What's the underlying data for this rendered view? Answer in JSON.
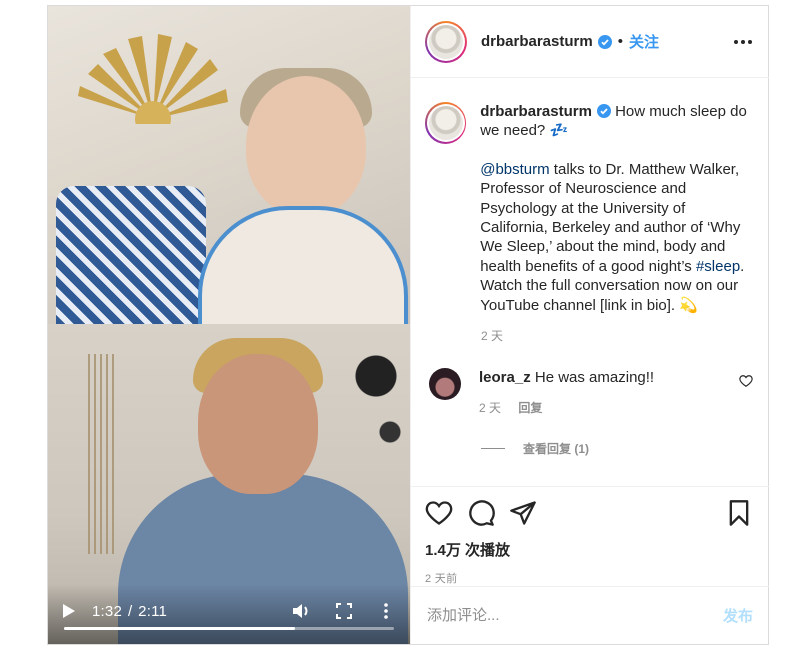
{
  "video": {
    "current_time": "1:32",
    "separator": "/",
    "duration": "2:11",
    "progress_fraction": 0.7
  },
  "header": {
    "username": "drbarbarasturm",
    "dot": "•",
    "follow_label": "关注"
  },
  "caption": {
    "username": "drbarbarasturm",
    "line1": "How much sleep do we need? 💤",
    "mention": "@bbsturm",
    "body_part1": " talks to Dr. Matthew Walker, Professor of Neuroscience and Psychology at the University of California, Berkeley and author of ‘Why We Sleep,’ about the mind, body and health benefits of a good night’s ",
    "hashtag": "#sleep",
    "body_part2": ". Watch the full conversation now on our YouTube channel [link in bio]. 💫",
    "age": "2 天"
  },
  "comment": {
    "username": "leora_z",
    "text": "He was amazing!!",
    "age": "2 天",
    "reply_label": "回复",
    "view_replies": "查看回复 (1)"
  },
  "stats": {
    "views": "1.4万 次播放",
    "post_age": "2 天前"
  },
  "comment_box": {
    "placeholder": "添加评论...",
    "post_label": "发布"
  },
  "colors": {
    "accent": "#3897f0",
    "post_disabled": "#b2dffc",
    "link": "#003569",
    "muted": "#8e8e8e"
  }
}
